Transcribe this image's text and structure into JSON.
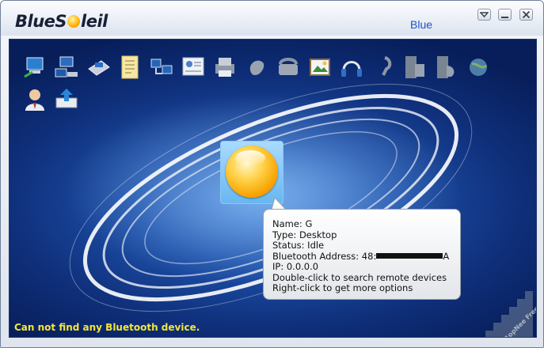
{
  "app": {
    "logo_text_before": "BlueS",
    "logo_text_after": "leil",
    "title_fragment": "Blue"
  },
  "toolbar": {
    "icons": [
      "network-access-icon",
      "dial-up-network-icon",
      "fax-printer-icon",
      "file-transfer-icon",
      "lan-access-icon",
      "personal-info-exchange-icon",
      "print-icon",
      "mouse-hid-icon",
      "phone-icon",
      "picture-transfer-icon",
      "headset-icon",
      "earpiece-icon",
      "serial-port-icon",
      "serial-port-2-icon",
      "sync-globe-icon",
      "user-icon",
      "printer-upload-icon"
    ]
  },
  "device": {
    "name_line": "Name: G",
    "type_line": "Type: Desktop",
    "status_line": "Status: Idle",
    "address_prefix": "Bluetooth Address: 48:",
    "address_suffix": "A",
    "ip_line": "IP: 0.0.0.0",
    "hint_double_click": "Double-click to search remote devices",
    "hint_right_click": "Right-click to get more options"
  },
  "status_message": "Can not find any Bluetooth device.",
  "watermark_text": "AppNee Freeware Group.",
  "colors": {
    "background_deep": "#0f2f7a",
    "status_text": "#f2e63a",
    "title_blue": "#2150c4"
  }
}
